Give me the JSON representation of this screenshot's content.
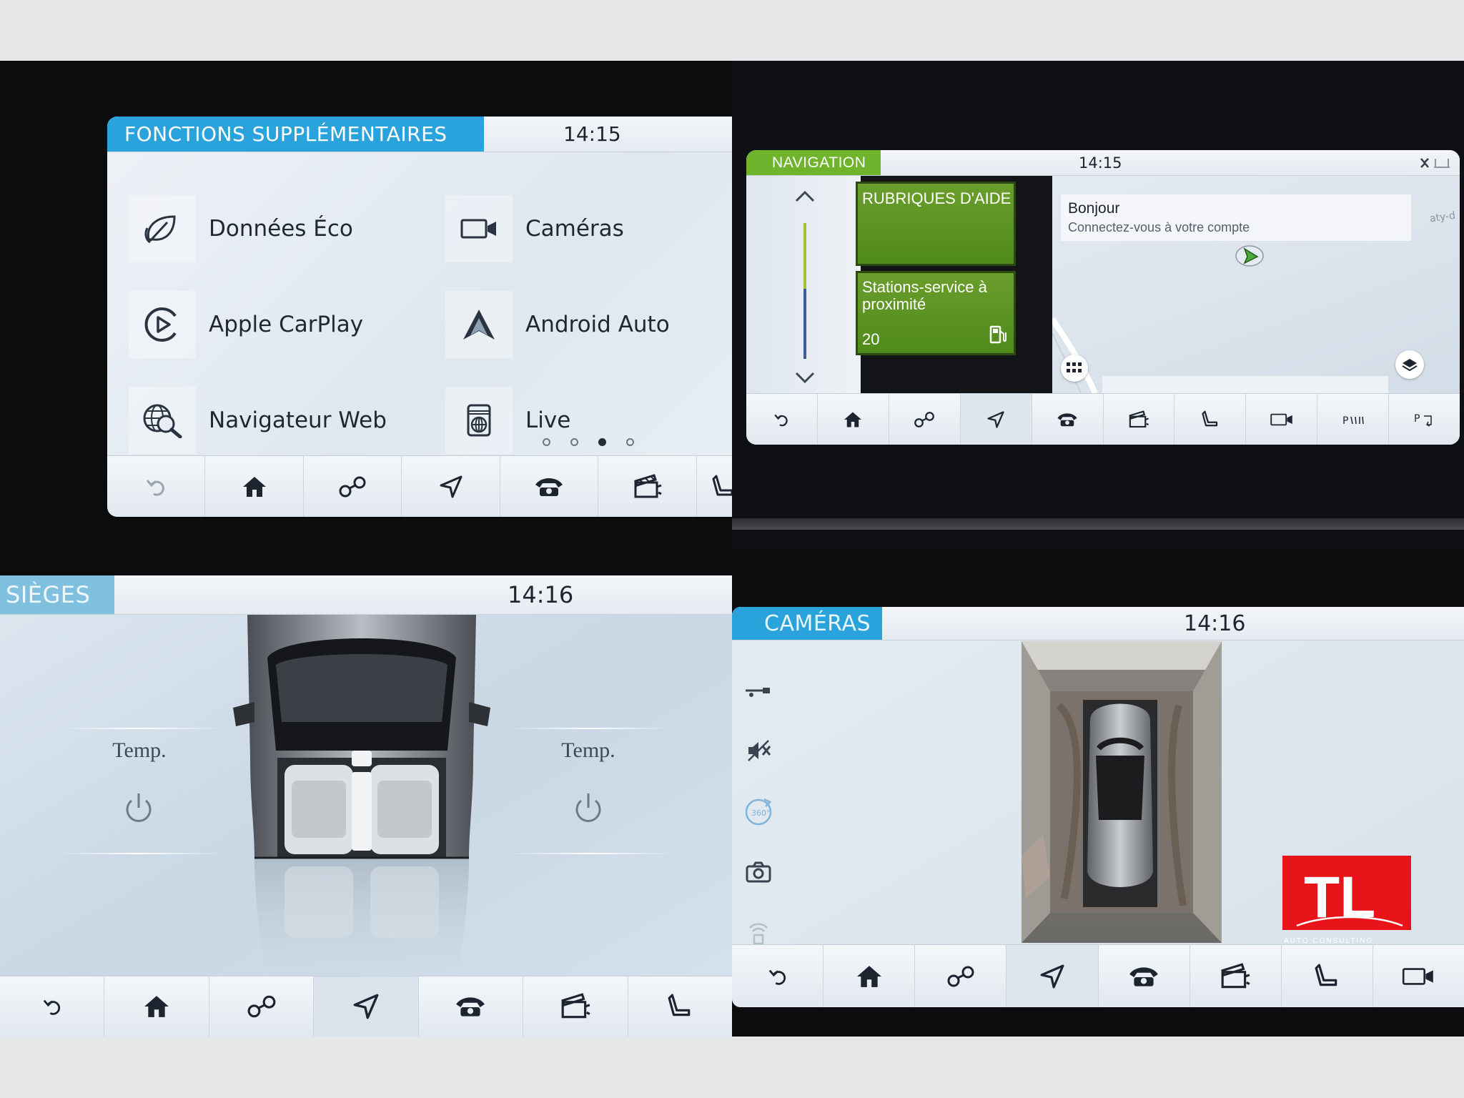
{
  "colors": {
    "header_blue": "#2aa3dc",
    "header_green": "#6fb42c",
    "tile_green": "#5a9324",
    "logo_red": "#e8141a"
  },
  "panel_functions": {
    "title": "FONCTIONS SUPPLÉMENTAIRES",
    "time": "14:15",
    "tiles": [
      {
        "label": "Données Éco",
        "icon": "eco-leaf-icon"
      },
      {
        "label": "Caméras",
        "icon": "camera-icon"
      },
      {
        "label": "Apple CarPlay",
        "icon": "carplay-icon"
      },
      {
        "label": "Android Auto",
        "icon": "android-auto-icon"
      },
      {
        "label": "Navigateur Web",
        "icon": "web-browser-icon"
      },
      {
        "label": "Live",
        "icon": "live-icon"
      }
    ],
    "page_dots": {
      "count": 4,
      "active": 3
    }
  },
  "panel_navigation": {
    "title": "NAVIGATION",
    "time": "14:15",
    "tile_help": "RUBRIQUES D'AIDE",
    "tile_fuel": "Stations-service à proximité",
    "tile_fuel_count": "20",
    "greeting_title": "Bonjour",
    "greeting_subtitle": "Connectez-vous à votre compte",
    "map_fragment": "aty-d"
  },
  "panel_seats": {
    "title": "SIÈGES",
    "time": "14:16",
    "left_label": "Temp.",
    "right_label": "Temp."
  },
  "panel_cameras": {
    "title": "CAMÉRAS",
    "time": "14:16",
    "side_icons": [
      "tow-bar-icon",
      "mute-guidelines-icon",
      "360-view-icon",
      "snapshot-camera-icon",
      "parking-sensor-icon"
    ]
  },
  "navbar_icons": [
    "back-icon",
    "home-icon",
    "connected-icon",
    "navigation-icon",
    "phone-icon",
    "media-icon",
    "seat-icon",
    "camera-icon",
    "parking-aid-icon",
    "park-assist-icon"
  ],
  "logo": {
    "text": "TL",
    "subtext": "AUTO CONSULTING"
  }
}
